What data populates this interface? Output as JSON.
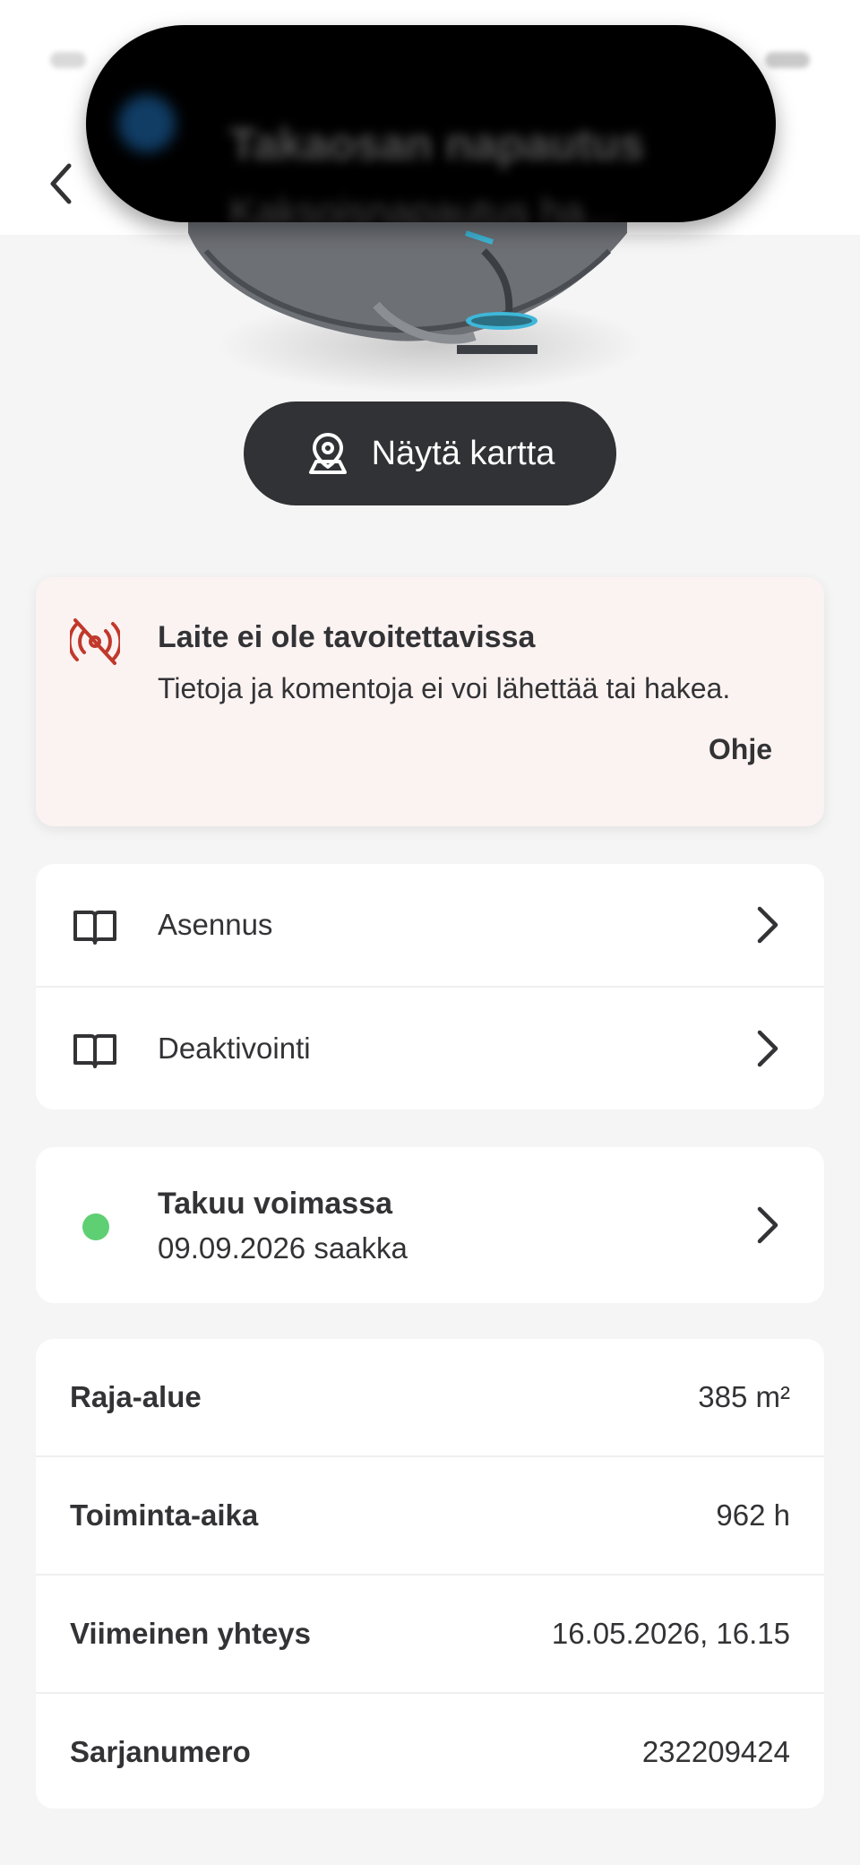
{
  "notification": {
    "title": "Takaosan napautus",
    "subtitle": "Kaksoisnapautus ha..."
  },
  "map_button": {
    "label": "Näytä kartta",
    "icon": "map-pin-icon"
  },
  "alert": {
    "title": "Laite ei ole tavoitettavissa",
    "text": "Tietoja ja komentoja ei voi lähettää tai hakea.",
    "help_label": "Ohje",
    "icon": "signal-off-icon",
    "icon_color": "#c0392b",
    "background": "#fbf3f2"
  },
  "links": [
    {
      "label": "Asennus",
      "icon": "book-icon"
    },
    {
      "label": "Deaktivointi",
      "icon": "book-icon"
    }
  ],
  "warranty": {
    "title": "Takuu voimassa",
    "subtitle": "09.09.2026 saakka",
    "status_color": "#5fcf73"
  },
  "stats": [
    {
      "label": "Raja-alue",
      "value": "385 m²"
    },
    {
      "label": "Toiminta-aika",
      "value": "962 h"
    },
    {
      "label": "Viimeinen yhteys",
      "value": "16.05.2026, 16.15"
    },
    {
      "label": "Sarjanumero",
      "value": "232209424"
    }
  ]
}
